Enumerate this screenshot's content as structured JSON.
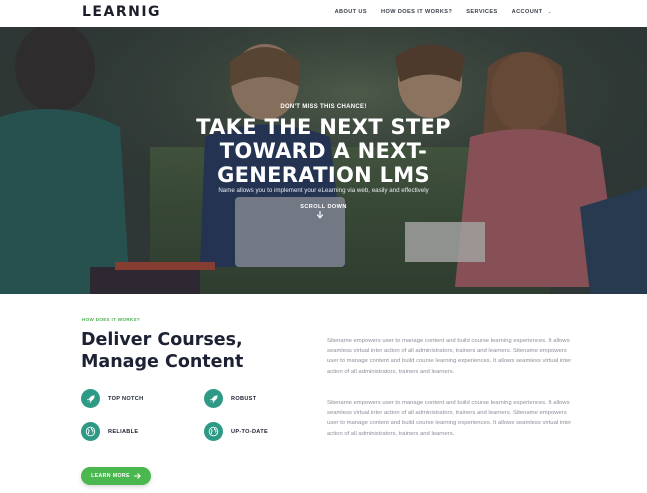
{
  "brand": {
    "logo": "LEARNIG"
  },
  "nav": {
    "items": [
      "ABOUT US",
      "HOW DOES IT WORKS?",
      "SERVICES",
      "ACCOUNT"
    ]
  },
  "hero": {
    "eyebrow": "DON'T MISS THIS CHANCE!",
    "title_line1": "TAKE THE NEXT STEP",
    "title_line2": "TOWARD A NEXT-",
    "title_line3": "GENERATION LMS",
    "subtitle": "Name allows you to implement your eLearning via web, easily and effectively",
    "scroll_label": "SCROLL DOWN"
  },
  "section": {
    "eyebrow": "HOW DOES IT WORKS?",
    "title_line1": "Deliver Courses,",
    "title_line2": "Manage Content",
    "features": [
      "TOP NOTCH",
      "ROBUST",
      "RELIABLE",
      "UP-TO-DATE"
    ],
    "cta": "LEARN MORE",
    "paragraph1": "Sitename empowers user to manage content and build course learning experiences. It allows seamless virtual inter action of all administrators, trainers and learners. Sitename empowers user to manage content and build course learning experiences. It allows seamless virtual inter action of all administrators, trainers and learners.",
    "paragraph2": "Sitename empowers user to manage content and build course learning experiences. It allows seamless virtual inter action of all administrators, trainers and learners. Sitename empowers user to manage content and build course learning experiences. It allows seamless virtual inter action of all administrators, trainers and learners."
  },
  "colors": {
    "accent_green": "#4ab74f",
    "icon_teal": "#2e9a86",
    "heading": "#1c2233"
  },
  "icons": [
    "rocket-icon",
    "globe-icon",
    "chevron-down-icon",
    "arrow-down-icon",
    "arrow-right-icon"
  ]
}
